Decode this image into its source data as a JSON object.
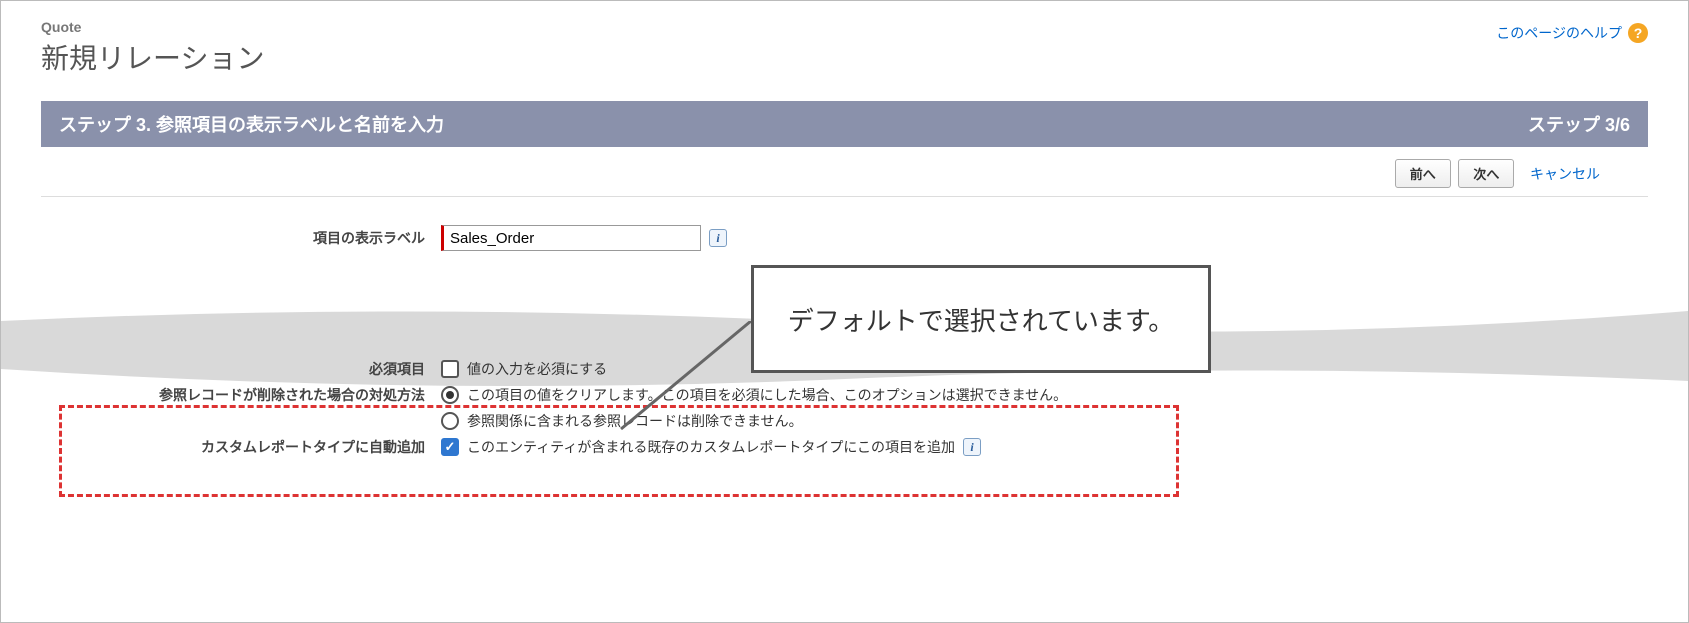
{
  "header": {
    "object_name": "Quote",
    "page_title": "新規リレーション",
    "help_link": "このページのヘルプ"
  },
  "step_bar": {
    "title": "ステップ 3. 参照項目の表示ラベルと名前を入力",
    "progress": "ステップ 3/6"
  },
  "buttons": {
    "prev": "前へ",
    "next": "次へ",
    "cancel": "キャンセル"
  },
  "form": {
    "display_label": {
      "label": "項目の表示ラベル",
      "value": "Sales_Order"
    },
    "required": {
      "label": "必須項目",
      "option": "値の入力を必須にする",
      "checked": false
    },
    "on_delete": {
      "label": "参照レコードが削除された場合の対処方法",
      "option_clear": "この項目の値をクリアします。この項目を必須にした場合、このオプションは選択できません。",
      "option_restrict": "参照関係に含まれる参照レコードは削除できません。",
      "selected": "clear"
    },
    "report_type": {
      "label": "カスタムレポートタイプに自動追加",
      "option": "このエンティティが含まれる既存のカスタムレポートタイプにこの項目を追加",
      "checked": true
    }
  },
  "callout": {
    "text": "デフォルトで選択されています。"
  }
}
